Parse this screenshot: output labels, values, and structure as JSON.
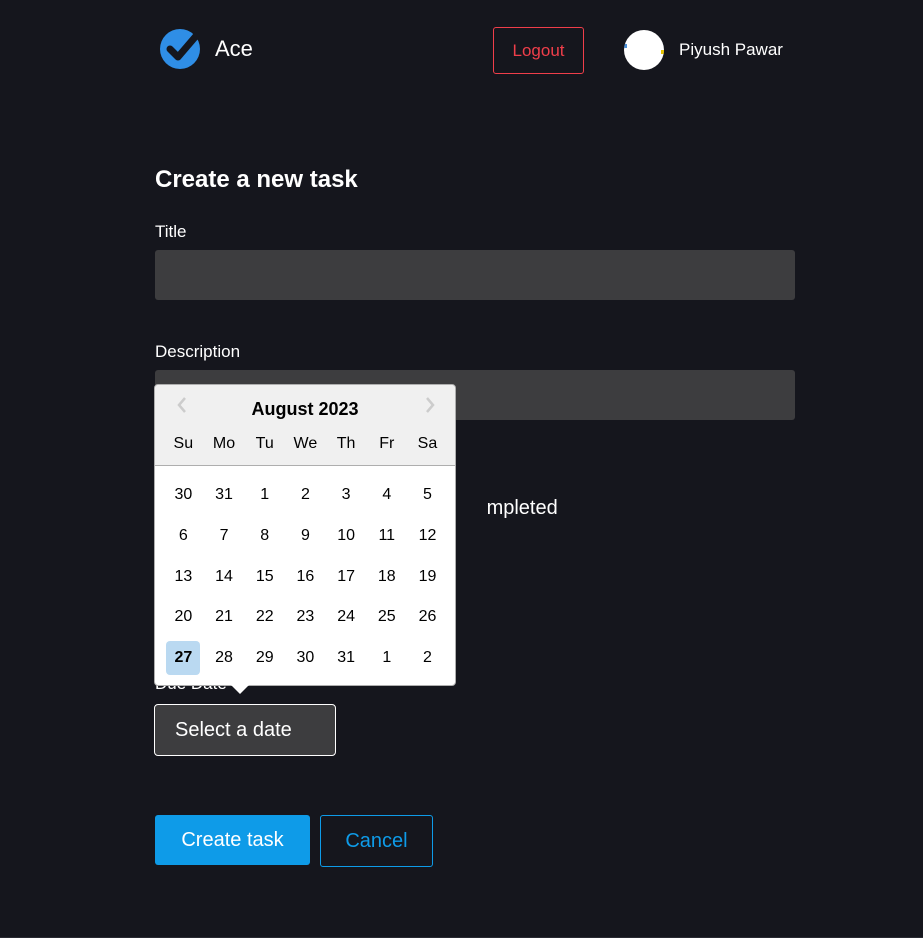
{
  "header": {
    "app_name": "Ace",
    "logout_label": "Logout",
    "user_name": "Piyush Pawar"
  },
  "form": {
    "title": "Create a new task",
    "title_label": "Title",
    "title_value": "",
    "description_label": "Description",
    "description_value": "",
    "completed_label_visible": "mpleted",
    "due_date_label_visible": "Due Date",
    "date_button_label": "Select a date",
    "create_label": "Create task",
    "cancel_label": "Cancel"
  },
  "datepicker": {
    "month_label": "August 2023",
    "weekdays": [
      "Su",
      "Mo",
      "Tu",
      "We",
      "Th",
      "Fr",
      "Sa"
    ],
    "weeks": [
      [
        "30",
        "31",
        "1",
        "2",
        "3",
        "4",
        "5"
      ],
      [
        "6",
        "7",
        "8",
        "9",
        "10",
        "11",
        "12"
      ],
      [
        "13",
        "14",
        "15",
        "16",
        "17",
        "18",
        "19"
      ],
      [
        "20",
        "21",
        "22",
        "23",
        "24",
        "25",
        "26"
      ],
      [
        "27",
        "28",
        "29",
        "30",
        "31",
        "1",
        "2"
      ]
    ],
    "selected_day": "27",
    "prev_icon": "chevron-left-icon",
    "next_icon": "chevron-right-icon"
  },
  "colors": {
    "background": "#15161d",
    "input_bg": "#3d3d3f",
    "accent_blue": "#0e9be8",
    "logout_red": "#ef3e4a",
    "selected_day_bg": "#bad9f1"
  }
}
